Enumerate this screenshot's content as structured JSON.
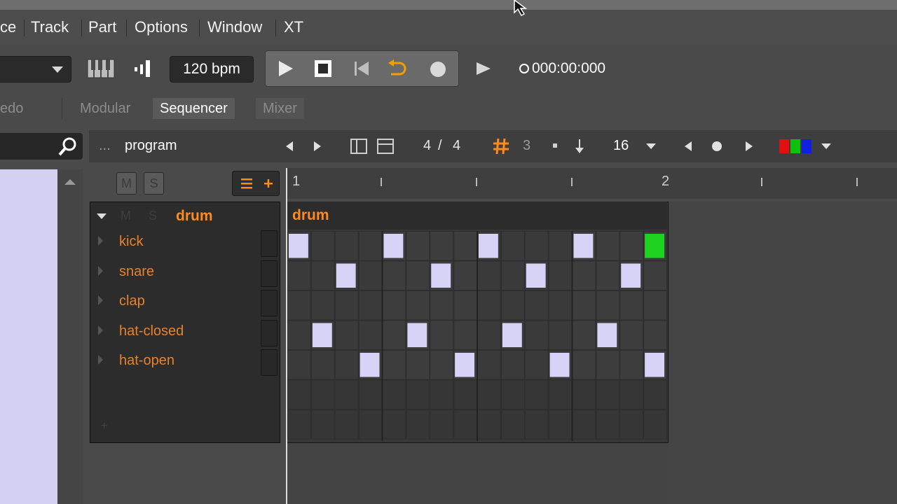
{
  "menu": {
    "items": [
      "ce",
      "Track",
      "Part",
      "Options",
      "Window",
      "XT"
    ]
  },
  "toolbar": {
    "bpm": "120 bpm",
    "time": "000:00:000"
  },
  "tabs": {
    "undo_label": "edo",
    "items": [
      "Modular",
      "Sequencer",
      "Mixer"
    ],
    "active": "Sequencer"
  },
  "sequencer_toolbar": {
    "ellipsis": "...",
    "program": "program",
    "time_signature_num": "4",
    "time_signature_sep": "/",
    "time_signature_den": "4",
    "grid_count": "3",
    "step_value": "16"
  },
  "track_header": {
    "mute": "M",
    "solo": "S"
  },
  "group": {
    "name": "drum",
    "mute": "M",
    "solo": "S"
  },
  "tracks": [
    "kick",
    "snare",
    "clap",
    "hat-closed",
    "hat-open"
  ],
  "ruler": {
    "bar_1": "1",
    "bar_2": "2"
  },
  "clip": {
    "name": "drum"
  },
  "pattern": {
    "steps_per_row": 16,
    "rows": [
      [
        1,
        0,
        0,
        0,
        1,
        0,
        0,
        0,
        1,
        0,
        0,
        0,
        1,
        0,
        0,
        0
      ],
      [
        0,
        0,
        1,
        0,
        0,
        0,
        1,
        0,
        0,
        0,
        1,
        0,
        0,
        0,
        1,
        0
      ],
      [
        0,
        0,
        0,
        0,
        0,
        0,
        0,
        0,
        0,
        0,
        0,
        0,
        0,
        0,
        0,
        0
      ],
      [
        0,
        1,
        0,
        0,
        0,
        1,
        0,
        0,
        0,
        1,
        0,
        0,
        0,
        1,
        0,
        0
      ],
      [
        0,
        0,
        0,
        1,
        0,
        0,
        0,
        1,
        0,
        0,
        0,
        1,
        0,
        0,
        0,
        1
      ]
    ],
    "highlight": {
      "row": 0,
      "step": 15
    }
  },
  "colors": {
    "accent": "#ff8a1f",
    "note": "#d6d3f6",
    "active_step": "#1fd21f",
    "browser": "#d3d1f1"
  }
}
